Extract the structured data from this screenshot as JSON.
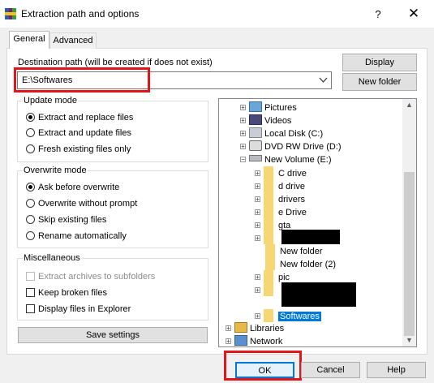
{
  "window": {
    "title": "Extraction path and options",
    "help_glyph": "?",
    "close_glyph": "✕",
    "app_icon": "winrar-icon"
  },
  "tabs": [
    {
      "label": "General",
      "selected": true
    },
    {
      "label": "Advanced",
      "selected": false
    }
  ],
  "destination": {
    "label": "Destination path (will be created if does not exist)",
    "value": "E:\\Softwares",
    "display_label": "Display",
    "new_folder_label": "New folder"
  },
  "update_mode": {
    "title": "Update mode",
    "options": [
      {
        "label": "Extract and replace files",
        "checked": true
      },
      {
        "label": "Extract and update files",
        "checked": false
      },
      {
        "label": "Fresh existing files only",
        "checked": false
      }
    ]
  },
  "overwrite_mode": {
    "title": "Overwrite mode",
    "options": [
      {
        "label": "Ask before overwrite",
        "checked": true
      },
      {
        "label": "Overwrite without prompt",
        "checked": false
      },
      {
        "label": "Skip existing files",
        "checked": false
      },
      {
        "label": "Rename automatically",
        "checked": false
      }
    ]
  },
  "misc": {
    "title": "Miscellaneous",
    "options": [
      {
        "label": "Extract archives to subfolders",
        "checked": false,
        "disabled": true
      },
      {
        "label": "Keep broken files",
        "checked": false,
        "disabled": false
      },
      {
        "label": "Display files in Explorer",
        "checked": false,
        "disabled": false
      }
    ]
  },
  "save_settings_label": "Save settings",
  "tree": {
    "items": [
      {
        "label": "Pictures",
        "icon": "pictures-folder-icon"
      },
      {
        "label": "Videos",
        "icon": "videos-folder-icon"
      },
      {
        "label": "Local Disk (C:)",
        "icon": "local-disk-icon"
      },
      {
        "label": "DVD RW Drive (D:)",
        "icon": "dvd-drive-icon"
      },
      {
        "label": "New Volume (E:)",
        "icon": "drive-icon"
      },
      {
        "label": "C drive",
        "icon": "folder-icon"
      },
      {
        "label": "d drive",
        "icon": "folder-icon"
      },
      {
        "label": "drivers",
        "icon": "folder-icon"
      },
      {
        "label": "e Drive",
        "icon": "folder-icon"
      },
      {
        "label": "gta",
        "icon": "folder-icon"
      },
      {
        "label": "New folder",
        "icon": "folder-icon"
      },
      {
        "label": "New folder (2)",
        "icon": "folder-icon"
      },
      {
        "label": "pic",
        "icon": "folder-icon"
      },
      {
        "label": "Softwares",
        "icon": "folder-icon",
        "selected": true
      },
      {
        "label": "Libraries",
        "icon": "libraries-icon"
      },
      {
        "label": "Network",
        "icon": "network-icon"
      }
    ]
  },
  "buttons": {
    "ok": "OK",
    "cancel": "Cancel",
    "help": "Help"
  },
  "colors": {
    "accent": "#0078d7",
    "highlight_red": "#e0161b",
    "folder": "#f7d774"
  }
}
